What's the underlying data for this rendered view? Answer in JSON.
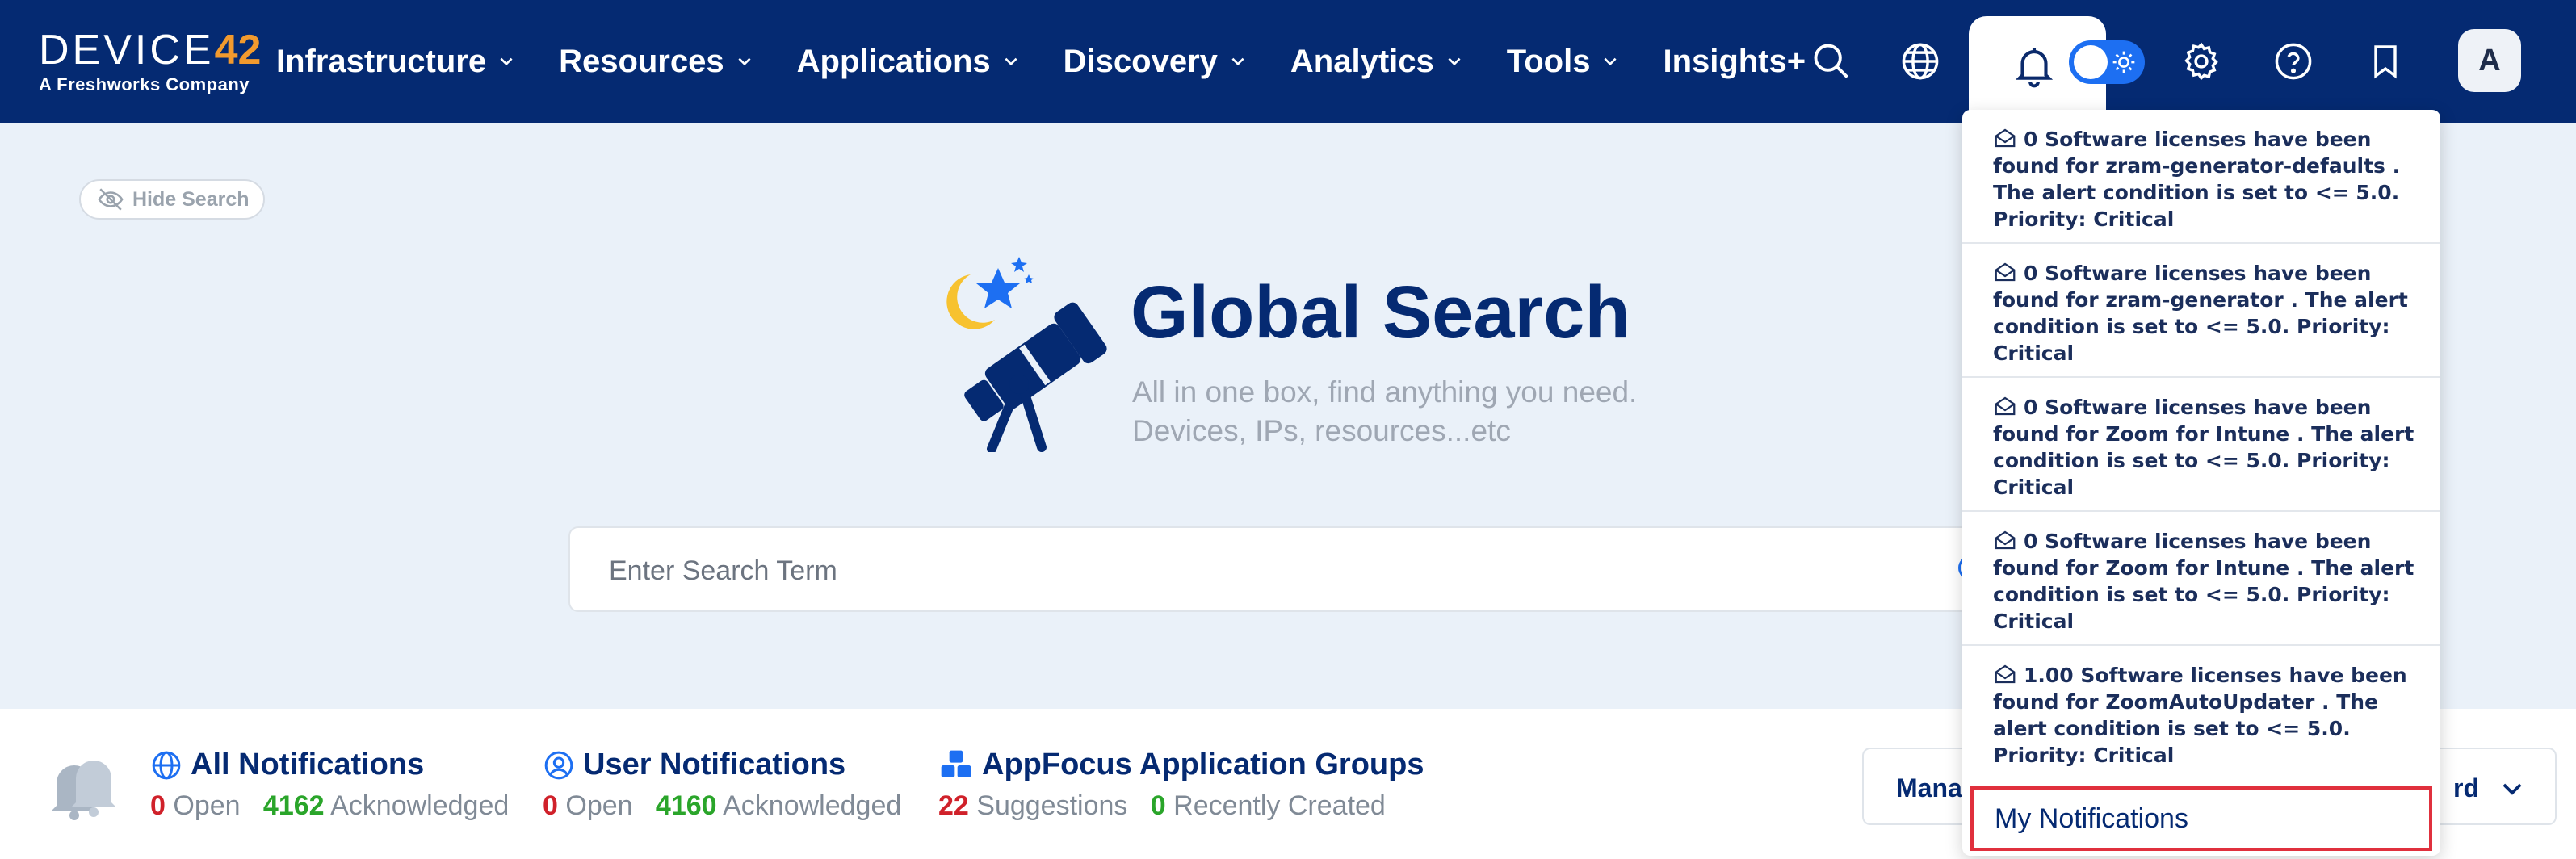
{
  "logo": {
    "word": "DEVICE",
    "number": "42",
    "subtitle": "A Freshworks Company"
  },
  "nav": [
    {
      "label": "Infrastructure",
      "dropdown": true
    },
    {
      "label": "Resources",
      "dropdown": true
    },
    {
      "label": "Applications",
      "dropdown": true
    },
    {
      "label": "Discovery",
      "dropdown": true
    },
    {
      "label": "Analytics",
      "dropdown": true
    },
    {
      "label": "Tools",
      "dropdown": true
    },
    {
      "label": "Insights+",
      "dropdown": false
    }
  ],
  "header_icons": [
    "search-icon",
    "globe-icon",
    "bell-icon",
    "theme-toggle",
    "gear-icon",
    "help-icon",
    "bookmark-icon"
  ],
  "user": {
    "avatar_letter": "A"
  },
  "hide_search": {
    "label": "Hide Search"
  },
  "hero": {
    "title": "Global Search",
    "subtitle_line1": "All in one box, find anything you need.",
    "subtitle_line2": "Devices, IPs, resources...etc"
  },
  "search": {
    "placeholder": "Enter Search Term",
    "value": ""
  },
  "notifications": [
    {
      "text": "0 Software licenses have been found for zram-generator-defaults . The alert condition is set to <= 5.0. Priority: Critical"
    },
    {
      "text": "0 Software licenses have been found for zram-generator . The alert condition is set to <= 5.0. Priority: Critical"
    },
    {
      "text": "0 Software licenses have been found for Zoom for Intune . The alert condition is set to <= 5.0. Priority: Critical"
    },
    {
      "text": "0 Software licenses have been found for Zoom for Intune . The alert condition is set to <= 5.0. Priority: Critical"
    },
    {
      "text": "1.00 Software licenses have been found for ZoomAutoUpdater . The alert condition is set to <= 5.0. Priority: Critical"
    }
  ],
  "my_notifications_label": "My Notifications",
  "stats": {
    "all": {
      "title": "All Notifications",
      "open_count": "0",
      "open_label": "Open",
      "ack_count": "4162",
      "ack_label": "Acknowledged"
    },
    "user": {
      "title": "User Notifications",
      "open_count": "0",
      "open_label": "Open",
      "ack_count": "4160",
      "ack_label": "Acknowledged"
    },
    "appfocus": {
      "title": "AppFocus Application Groups",
      "sugg_count": "22",
      "sugg_label": "Suggestions",
      "recent_count": "0",
      "recent_label": "Recently Created"
    }
  },
  "dashboard_select": {
    "label_start": "Manag",
    "label_end": "rd"
  },
  "colors": {
    "nav_bg": "#052a72",
    "accent": "#1d6ff2",
    "brand_orange": "#f29a2e",
    "open_red": "#d0212a",
    "ack_green": "#2aa52a",
    "highlight_border": "#e0303d"
  }
}
